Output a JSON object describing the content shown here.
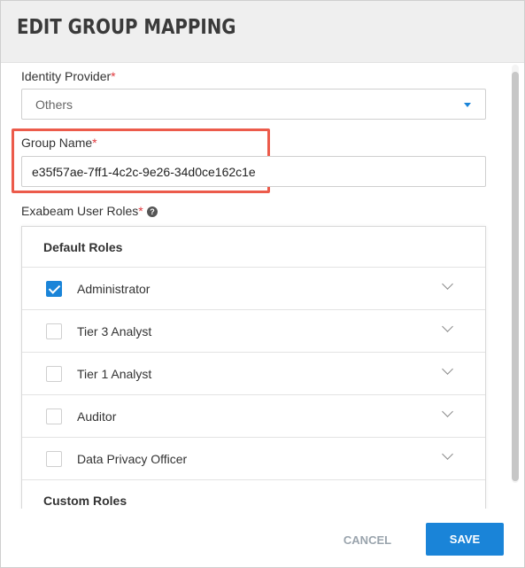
{
  "dialog": {
    "title": "EDIT GROUP MAPPING"
  },
  "identity_provider": {
    "label": "Identity Provider",
    "required_mark": "*",
    "selected": "Others"
  },
  "group_name": {
    "label": "Group Name",
    "required_mark": "*",
    "value": "e35f57ae-7ff1-4c2c-9e26-34d0ce162c1e"
  },
  "user_roles": {
    "label": "Exabeam User Roles",
    "required_mark": "*",
    "help_glyph": "?",
    "default_section_title": "Default Roles",
    "custom_section_title": "Custom Roles",
    "roles": [
      {
        "label": "Administrator",
        "checked": true
      },
      {
        "label": "Tier 3 Analyst",
        "checked": false
      },
      {
        "label": "Tier 1 Analyst",
        "checked": false
      },
      {
        "label": "Auditor",
        "checked": false
      },
      {
        "label": "Data Privacy Officer",
        "checked": false
      }
    ]
  },
  "footer": {
    "cancel_label": "CANCEL",
    "save_label": "SAVE"
  },
  "colors": {
    "accent": "#1a84d8",
    "required": "#e0393e",
    "highlight": "#ec5b4b",
    "header_bg": "#efefef"
  },
  "icons": {
    "dropdown": "caret-down-icon",
    "help": "question-circle-icon",
    "expand": "chevron-down-icon",
    "check": "checkmark-icon"
  }
}
